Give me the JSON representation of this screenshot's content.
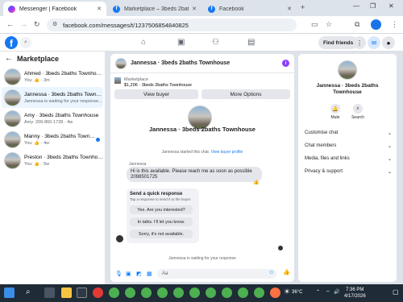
{
  "browser": {
    "tabs": [
      {
        "title": "Messenger | Facebook",
        "active": true,
        "favicon": "messenger-icon"
      },
      {
        "title": "Marketplace – 3beds 2baths To",
        "active": false,
        "favicon": "facebook-icon"
      },
      {
        "title": "Facebook",
        "active": false,
        "favicon": "facebook-icon"
      }
    ],
    "new_tab": "+",
    "url": "facebook.com/messages/t/1237506854840825",
    "window_controls": [
      "—",
      "❐",
      "✕"
    ]
  },
  "fb_header": {
    "logo": "f",
    "find_friends_label": "Find friends"
  },
  "marketplace": {
    "title": "Marketplace",
    "threads": [
      {
        "name": "Ahmed · 3beds 2baths Townhouse",
        "preview": "You: 👍 · 3m",
        "selected": false,
        "unread": false
      },
      {
        "name": "Jannessa · 3beds 2baths Townhouse",
        "preview": "Jannessa is waiting for your response · 2h",
        "selected": true,
        "unread": false
      },
      {
        "name": "Amy · 3beds 2baths Townhouse",
        "preview": "Amy: 209-860-1728 · 4w",
        "selected": false,
        "unread": false
      },
      {
        "name": "Manny · 3beds 2baths Townhouse",
        "preview": "You: 👍 · 4w",
        "selected": false,
        "unread": true
      },
      {
        "name": "Preston · 3beds 2baths Townhouse",
        "preview": "You: 👍 · 5w",
        "selected": false,
        "unread": false
      }
    ]
  },
  "chat": {
    "header_name": "Jannessa · 3beds 2baths Townhouse",
    "listing_label": "Marketplace",
    "listing_price": "$1,206 · 3beds 2baths Townhouse",
    "view_buyer_label": "View buyer",
    "more_options_label": "More Options",
    "profile_name": "Jannessa · 3beds 2baths Townhouse",
    "started_text": "Jannessa started this chat.",
    "view_profile_link": "View buyer profile",
    "sender": "Jannessa",
    "message_line1": "Hi is this available. Please reach me as soon as possible",
    "message_line2": "2098501725",
    "quick_title": "Send a quick response",
    "quick_sub": "Tap a response to send it to the buyer.",
    "quick_options": [
      "Yes. Are you interested?",
      "In talks. I'll let you know.",
      "Sorry, it's not available."
    ],
    "waiting_text": "Jannessa is waiting for your response",
    "composer_placeholder": "Aa"
  },
  "info_panel": {
    "name_line1": "Jannessa · 3beds 2baths",
    "name_line2": "Townhouse",
    "mute_label": "Mute",
    "search_label": "Search",
    "sections": [
      "Customise chat",
      "Chat members",
      "Media, files and links",
      "Privacy & support"
    ]
  },
  "taskbar": {
    "weather": "36°C",
    "time": "7:36 PM",
    "date": "4/17/2026"
  },
  "colors": {
    "fb_blue": "#1877f2",
    "messenger_blue": "#0a7cff",
    "taskbar": "#1f2b36"
  }
}
